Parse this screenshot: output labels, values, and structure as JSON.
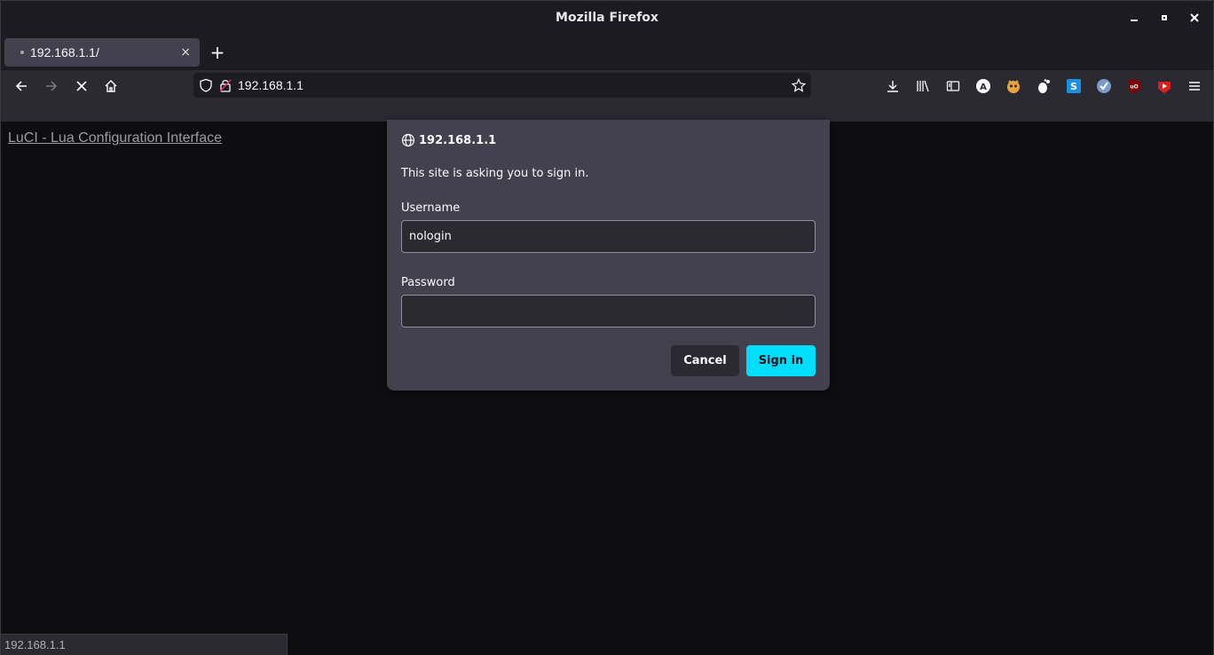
{
  "window": {
    "title": "Mozilla Firefox"
  },
  "tabs": [
    {
      "label": "192.168.1.1/",
      "close": "×"
    }
  ],
  "newtab_label": "+",
  "urlbar": {
    "url": "192.168.1.1"
  },
  "page": {
    "link_text": "LuCI - Lua Configuration Interface"
  },
  "dialog": {
    "host": "192.168.1.1",
    "message": "This site is asking you to sign in.",
    "username_label": "Username",
    "username_value": "nologin",
    "password_label": "Password",
    "password_value": "",
    "cancel_label": "Cancel",
    "signin_label": "Sign in"
  },
  "statusbar": {
    "text": "192.168.1.1"
  },
  "toolbar_icons": [
    "download-icon",
    "library-icon",
    "sidebar-icon",
    "extension-a-icon",
    "extension-fox-icon",
    "extension-gnome-icon",
    "extension-s-icon",
    "extension-check-icon",
    "ublock-icon",
    "youtube-icon",
    "menu-icon"
  ],
  "colors": {
    "accent": "#00ddff",
    "dialog_bg": "#42414d",
    "content_bg": "#0e0e11"
  }
}
